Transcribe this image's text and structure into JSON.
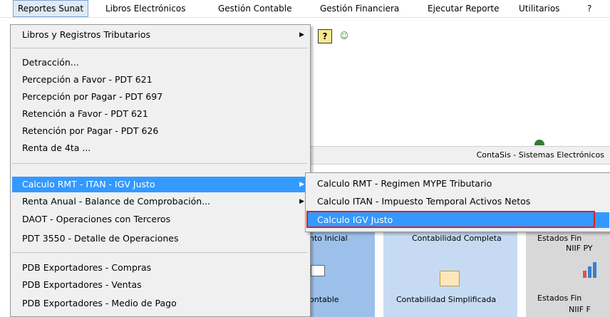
{
  "menubar": {
    "items": [
      "Reportes Sunat",
      "Libros Electrónicos",
      "Gestión Contable",
      "Gestión Financiera",
      "Ejecutar Reporte",
      "Utilitarios",
      "?"
    ]
  },
  "main_menu": {
    "items": [
      "Libros y Registros Tributarios",
      "Detracción...",
      "Percepción a Favor - PDT 621",
      "Percepción por Pagar - PDT 697",
      "Retención a Favor - PDT 621",
      "Retención por Pagar - PDT 626",
      "Renta de 4ta ...",
      "Calculo RMT - ITAN - IGV Justo",
      "Renta Anual - Balance de Comprobación...",
      "DAOT - Operaciones con Terceros",
      "PDT 3550 - Detalle de Operaciones",
      "PDB Exportadores - Compras",
      "PDB Exportadores - Ventas",
      "PDB Exportadores - Medio de Pago"
    ]
  },
  "submenu": {
    "items": [
      "Calculo RMT - Regimen MYPE Tributario",
      "Calculo ITAN - Impuesto Temporal Activos Netos",
      "Calculo IGV Justo"
    ]
  },
  "background": {
    "status_text": "ContaSis - Sistemas Electrónicos",
    "tiles": {
      "a_top": "nto Inicial",
      "a_bottom": "ontable",
      "b_top": "Contabilidad Completa",
      "b_bottom": "Contabilidad Simplificada",
      "c_top1": "Estados Fin",
      "c_top2": "NIIF PY",
      "c_bottom1": "Estados Fin",
      "c_bottom2": "NIIF F"
    }
  },
  "colors": {
    "highlight": "#3399ff",
    "menu_bg": "#f0f0f0",
    "annotation": "#e11d1d"
  }
}
